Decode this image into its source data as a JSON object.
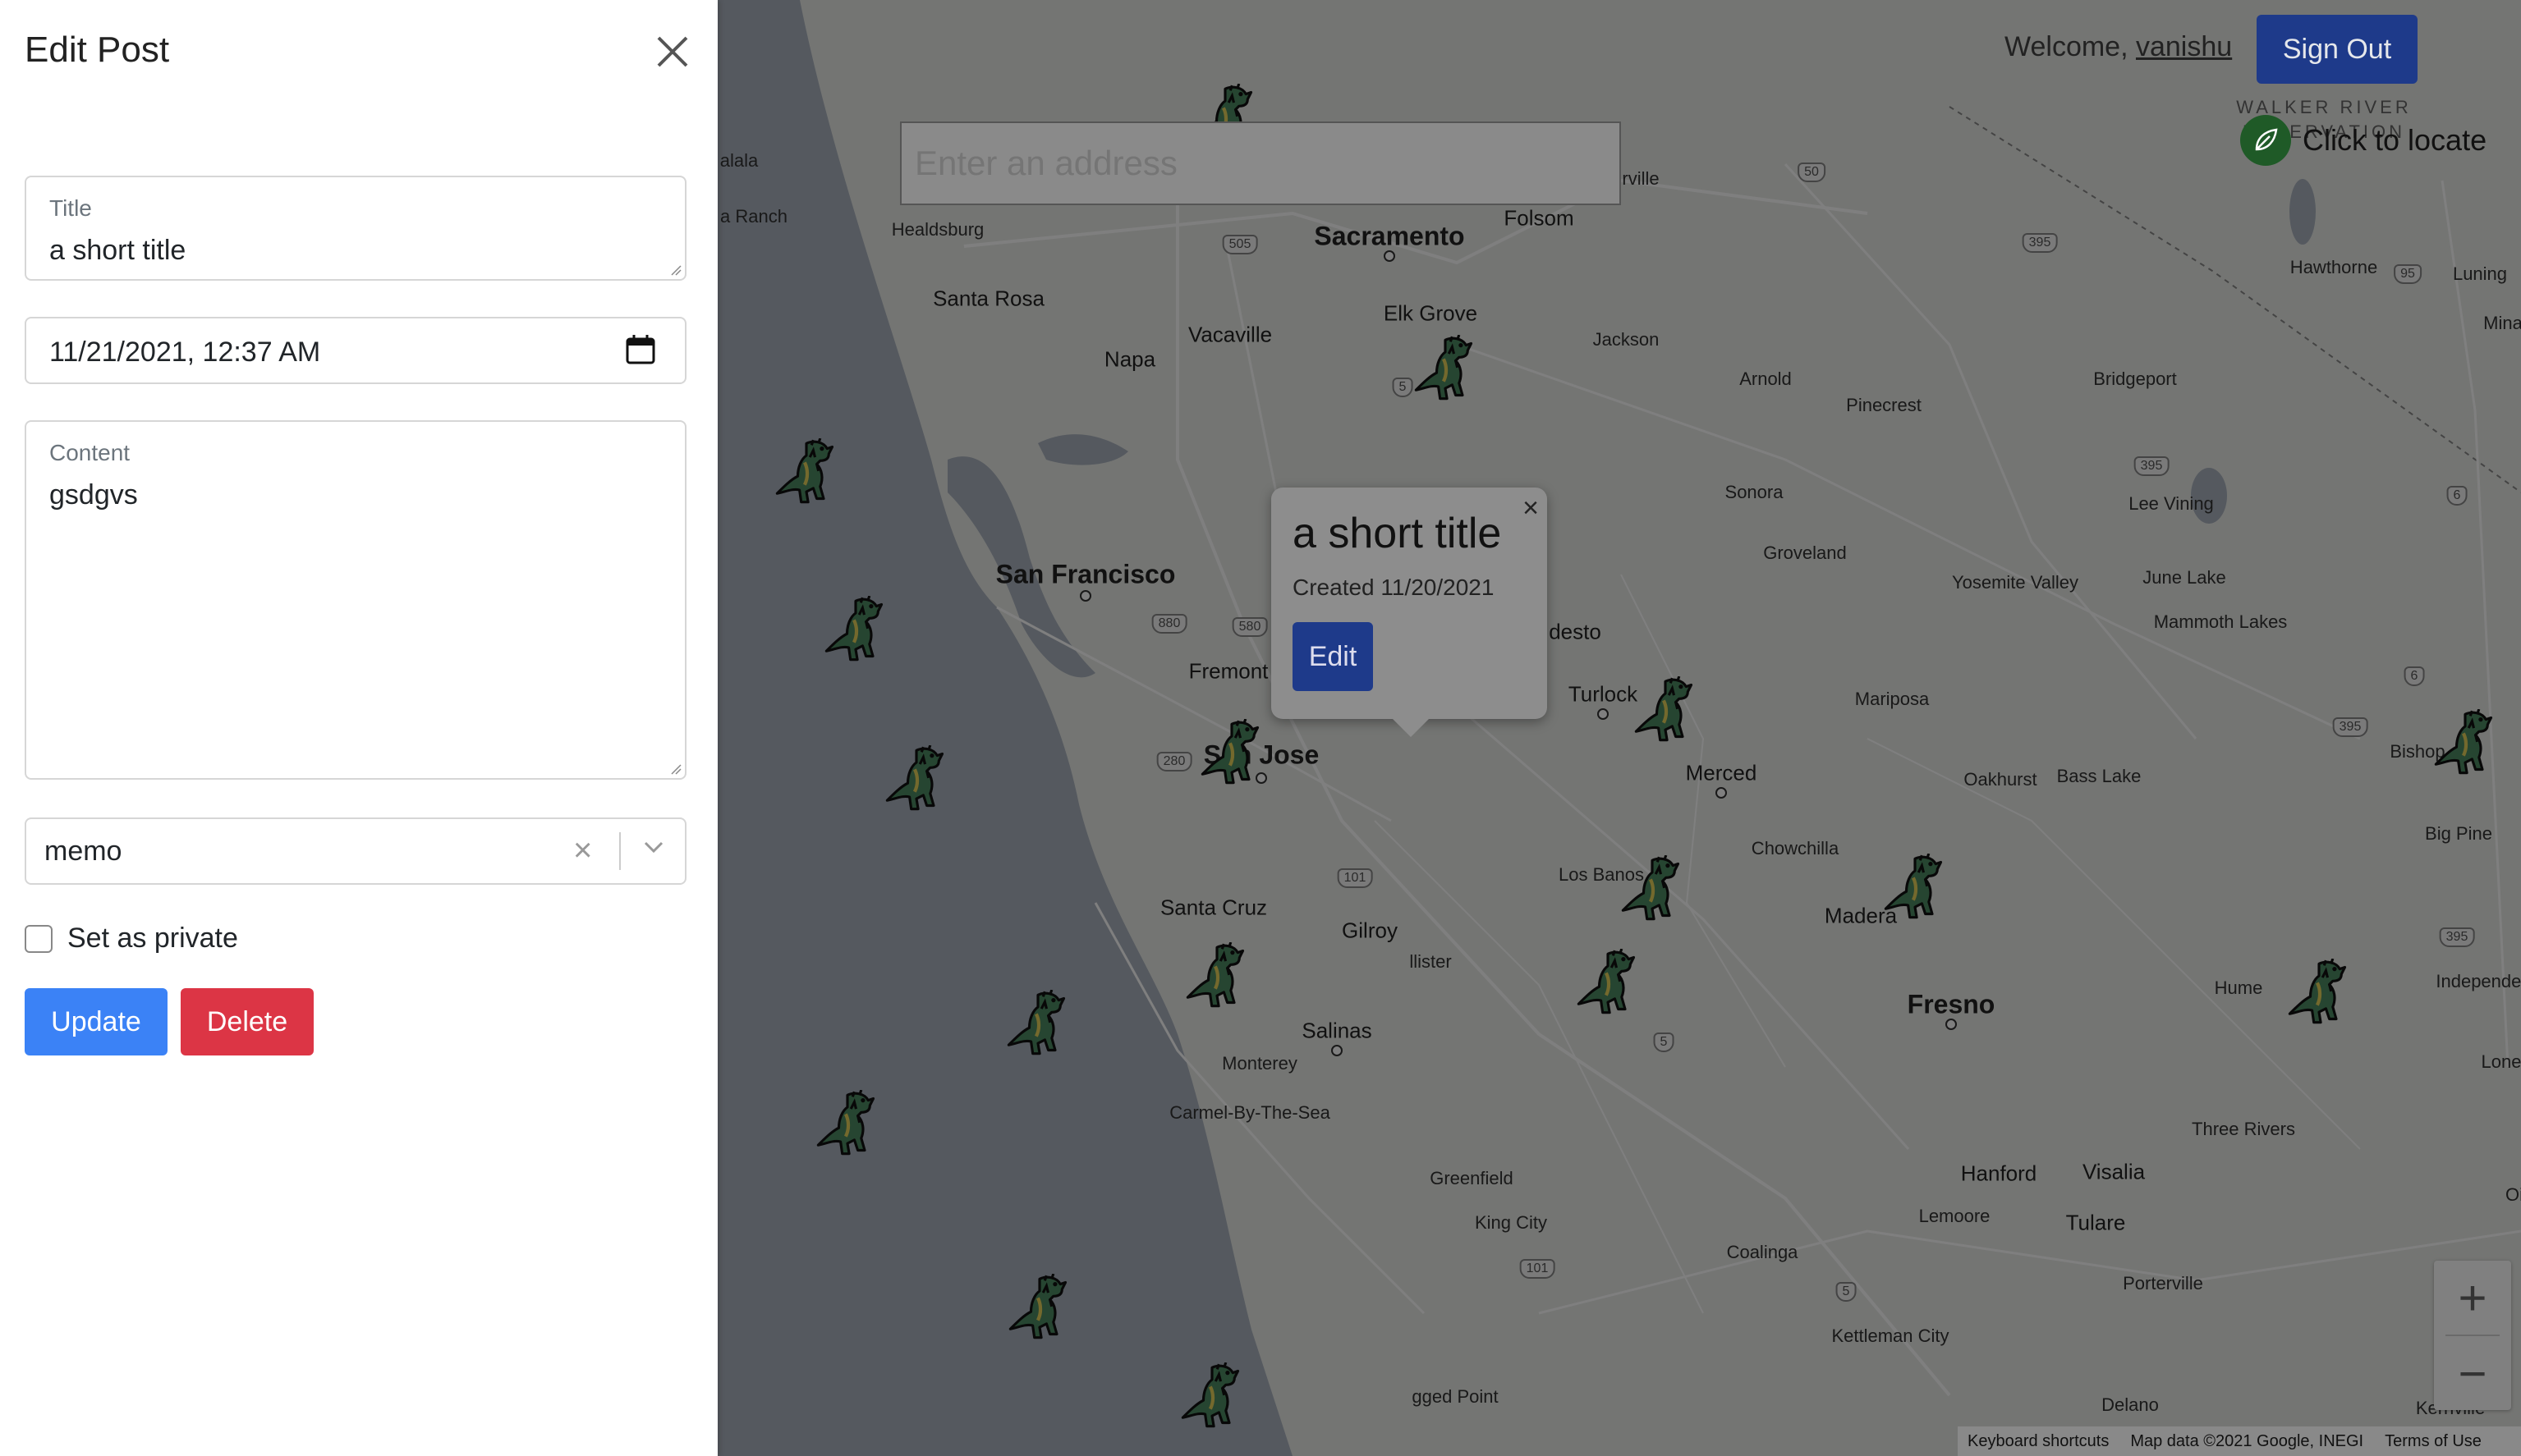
{
  "drawer": {
    "title": "Edit Post",
    "title_field": {
      "label": "Title",
      "value": "a short title"
    },
    "date_field": {
      "value": "11/21/2021, 12:37  AM"
    },
    "content_field": {
      "label": "Content",
      "value": "gsdgvs"
    },
    "tag_select": {
      "value": "memo",
      "clear_symbol": "×"
    },
    "private_label": "Set as private",
    "update_label": "Update",
    "delete_label": "Delete"
  },
  "header": {
    "welcome_text": "Welcome,",
    "username": "vanishu",
    "signout_label": "Sign Out"
  },
  "search": {
    "placeholder": "Enter an address"
  },
  "locate": {
    "label": "Click to locate"
  },
  "popup": {
    "title": "a short title",
    "created": "Created 11/20/2021",
    "edit_label": "Edit",
    "close_symbol": "×"
  },
  "map": {
    "cities_big": [
      "Sacramento",
      "San Francisco",
      "San Jose",
      "Fresno"
    ],
    "cities_med": [
      "Santa Rosa",
      "Napa",
      "Vacaville",
      "Elk Grove",
      "Folsom",
      "Fremont",
      "Turlock",
      "Merced",
      "Santa Cruz",
      "Gilroy",
      "Salinas",
      "Visalia",
      "Madera",
      "Hanford",
      "Tulare",
      "desto"
    ],
    "cities_sm": [
      "Healdsburg",
      "Jackson",
      "Arnold",
      "Pinecrest",
      "Bridgeport",
      "Sonora",
      "Groveland",
      "Yosemite Valley",
      "June Lake",
      "Mammoth Lakes",
      "Lee Vining",
      "Mariposa",
      "Oakhurst",
      "Bass Lake",
      "Chowchilla",
      "Los Banos",
      "Monterey",
      "Carmel-By-The-Sea",
      "Greenfield",
      "King City",
      "Lemoore",
      "Three Rivers",
      "Coalinga",
      "Porterville",
      "Kettleman City",
      "Delano",
      "Kernville",
      "Hume",
      "Big Pine",
      "Bishop",
      "Independenc",
      "Lone",
      "Hawthorne",
      "Luning",
      "Mina",
      "rville",
      "alala",
      "a Ranch",
      "llister",
      "gged Point",
      "Oi"
    ],
    "reservation_label": "WALKER RIVER RESERVATION",
    "route_shields": [
      "50",
      "505",
      "5",
      "395",
      "395",
      "6",
      "6",
      "395",
      "95",
      "880",
      "580",
      "280",
      "101",
      "101",
      "5",
      "5",
      "395"
    ],
    "footer": {
      "shortcuts": "Keyboard shortcuts",
      "data": "Map data ©2021 Google, INEGI",
      "terms": "Terms of Use"
    },
    "zoom_in": "+",
    "zoom_out": "−"
  },
  "colors": {
    "primary": "#3b5bdb",
    "update": "#3b82f6",
    "delete": "#dc3545",
    "locate_green": "#2f8a3b",
    "dino_green": "#4c8a63"
  }
}
